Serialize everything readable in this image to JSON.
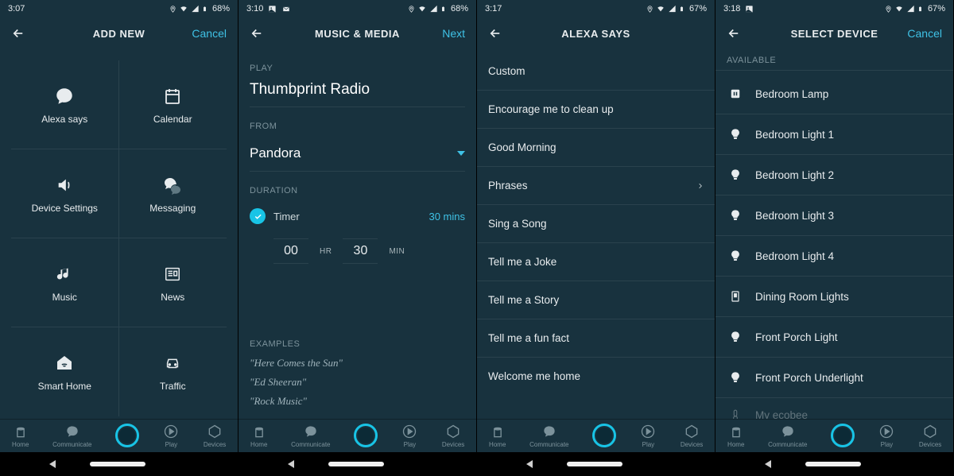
{
  "status": {
    "signal_icons": true,
    "battery_icon": true
  },
  "screens": [
    {
      "time": "3:07",
      "battery": "68%",
      "extra_icons": [],
      "title": "ADD NEW",
      "action": {
        "label": "Cancel",
        "color": "accent"
      },
      "grid": [
        {
          "icon": "chat-bubble",
          "label": "Alexa says"
        },
        {
          "icon": "calendar",
          "label": "Calendar"
        },
        {
          "icon": "speaker",
          "label": "Device Settings"
        },
        {
          "icon": "chat-bubbles",
          "label": "Messaging"
        },
        {
          "icon": "music-note",
          "label": "Music"
        },
        {
          "icon": "news",
          "label": "News"
        },
        {
          "icon": "smart-home",
          "label": "Smart Home"
        },
        {
          "icon": "car",
          "label": "Traffic"
        }
      ]
    },
    {
      "time": "3:10",
      "battery": "68%",
      "extra_icons": [
        "picture",
        "mail"
      ],
      "title": "MUSIC & MEDIA",
      "action": {
        "label": "Next",
        "color": "accent"
      },
      "play_label": "PLAY",
      "play_value": "Thumbprint Radio",
      "from_label": "FROM",
      "from_value": "Pandora",
      "duration_label": "DURATION",
      "timer_label": "Timer",
      "timer_value": "30 mins",
      "picker": {
        "hh": "00",
        "hh_unit": "HR",
        "mm": "30",
        "mm_unit": "MIN"
      },
      "examples_label": "EXAMPLES",
      "examples": [
        "\"Here Comes the Sun\"",
        "\"Ed Sheeran\"",
        "\"Rock Music\""
      ]
    },
    {
      "time": "3:17",
      "battery": "67%",
      "extra_icons": [],
      "title": "ALEXA SAYS",
      "action": null,
      "items": [
        {
          "label": "Custom"
        },
        {
          "label": "Encourage me to clean up"
        },
        {
          "label": "Good Morning"
        },
        {
          "label": "Phrases",
          "chevron": true
        },
        {
          "label": "Sing a Song"
        },
        {
          "label": "Tell me a Joke"
        },
        {
          "label": "Tell me a Story"
        },
        {
          "label": "Tell me a fun fact"
        },
        {
          "label": "Welcome me home"
        }
      ]
    },
    {
      "time": "3:18",
      "battery": "67%",
      "extra_icons": [
        "picture"
      ],
      "title": "SELECT DEVICE",
      "action": {
        "label": "Cancel",
        "color": "accent"
      },
      "section": "AVAILABLE",
      "devices": [
        {
          "icon": "plug",
          "label": "Bedroom Lamp"
        },
        {
          "icon": "bulb",
          "label": "Bedroom Light 1"
        },
        {
          "icon": "bulb",
          "label": "Bedroom Light 2"
        },
        {
          "icon": "bulb",
          "label": "Bedroom Light 3"
        },
        {
          "icon": "bulb",
          "label": "Bedroom Light 4"
        },
        {
          "icon": "switch",
          "label": "Dining Room Lights"
        },
        {
          "icon": "bulb",
          "label": "Front Porch Light"
        },
        {
          "icon": "bulb",
          "label": "Front Porch Underlight"
        },
        {
          "icon": "thermo",
          "label": "My ecobee",
          "faded": true
        }
      ]
    }
  ],
  "nav": {
    "items": [
      {
        "icon": "home",
        "label": "Home"
      },
      {
        "icon": "chat-bubble",
        "label": "Communicate"
      },
      {
        "icon": "alexa",
        "label": ""
      },
      {
        "icon": "play",
        "label": "Play"
      },
      {
        "icon": "devices",
        "label": "Devices"
      }
    ]
  }
}
